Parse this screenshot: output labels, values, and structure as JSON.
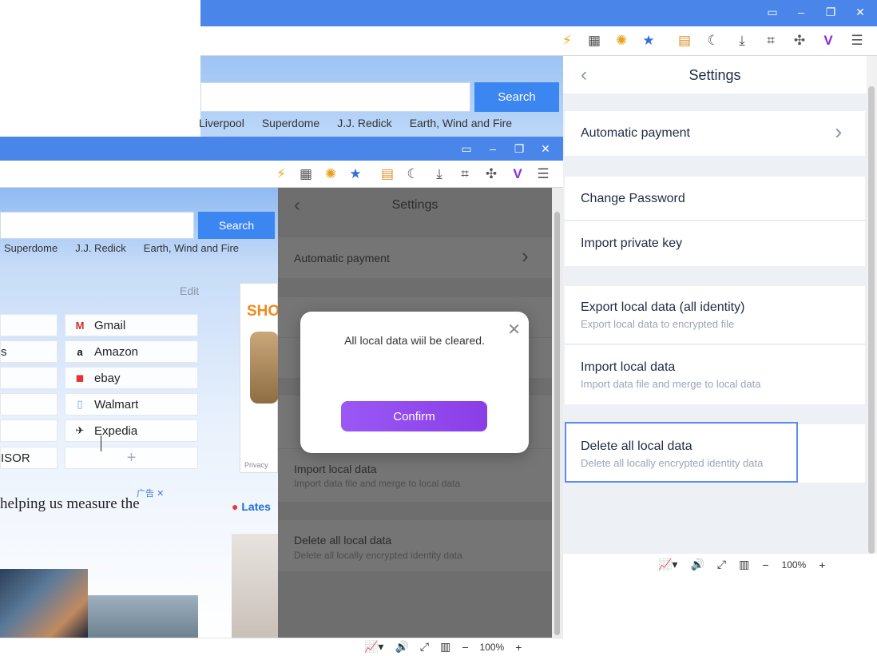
{
  "back_window": {
    "search_button": "Search",
    "hot_links": [
      "Liverpool",
      "Superdome",
      "J.J. Redick",
      "Earth, Wind and Fire"
    ]
  },
  "front_window": {
    "search_button": "Search",
    "hot_links": [
      "Superdome",
      "J.J. Redick",
      "Earth, Wind and Fire"
    ],
    "edit_label": "Edit",
    "sites_right": [
      {
        "label": "Gmail",
        "icon": "gmail-icon"
      },
      {
        "label": "Amazon",
        "icon": "amazon-icon"
      },
      {
        "label": "ebay",
        "icon": "ebay-icon"
      },
      {
        "label": "Walmart",
        "icon": "walmart-icon"
      },
      {
        "label": "Expedia",
        "icon": "expedia-icon"
      }
    ],
    "sites_left_fragments": [
      "s",
      "ISOR"
    ],
    "add_symbol": "+",
    "ad_marker": "广告",
    "ad_text": "helping us measure the",
    "ad_banner_text": "SHO",
    "privacy_label": "Privacy",
    "latest_label": "Lates",
    "settings": {
      "title": "Settings",
      "automatic_payment": "Automatic payment",
      "import_local_data": "Import local data",
      "import_local_data_sub": "Import data file and merge to local data",
      "delete_all_local_data": "Delete all local data",
      "delete_all_local_data_sub": "Delete all locally encrypted identity data"
    },
    "zoom": "100%"
  },
  "modal": {
    "message": "All local data wiil be cleared.",
    "confirm_label": "Confirm"
  },
  "right_settings": {
    "title": "Settings",
    "automatic_payment": "Automatic payment",
    "change_password": "Change Password",
    "import_private_key": "Import private key",
    "export_local_data": "Export local data (all identity)",
    "export_local_data_sub": "Export local data to encrypted file",
    "import_local_data": "Import local data",
    "import_local_data_sub": "Import data file and merge to local data",
    "delete_all_local_data": "Delete all local data",
    "delete_all_local_data_sub": "Delete all locally encrypted identity data",
    "zoom": "100%"
  },
  "colors": {
    "title_bar": "#4a86ea",
    "confirm_purple": "#8a3ee6",
    "focus_outline": "#5b8def"
  }
}
